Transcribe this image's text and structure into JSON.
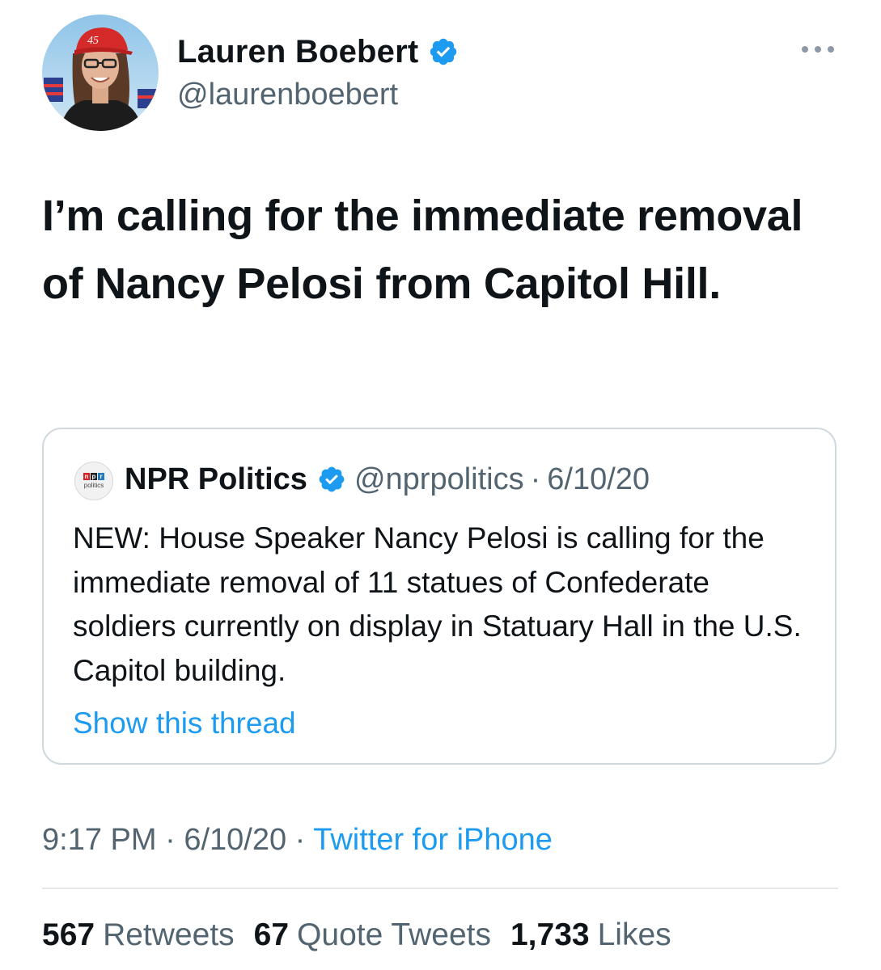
{
  "author": {
    "name": "Lauren Boebert",
    "handle": "@laurenboebert",
    "cap_text": "45"
  },
  "tweet": {
    "text": "I’m calling for the immediate removal of Nancy Pelosi from Capitol Hill."
  },
  "quote": {
    "name": "NPR Politics",
    "handle": "@nprpolitics",
    "separator": "·",
    "date": "6/10/20",
    "text": "NEW: House Speaker Nancy Pelosi is calling for the immediate removal of 11 statues of Confederate soldiers currently on display in Statuary Hall in the U.S. Capitol building.",
    "show_thread": "Show this thread",
    "logo_letters": [
      "n",
      "p",
      "r"
    ],
    "logo_sub": "politics"
  },
  "meta": {
    "time": "9:17 PM",
    "separator": "·",
    "date": "6/10/20",
    "source": "Twitter for iPhone"
  },
  "stats": {
    "retweets_count": "567",
    "retweets_label": "Retweets",
    "quotes_count": "67",
    "quotes_label": "Quote Tweets",
    "likes_count": "1,733",
    "likes_label": "Likes"
  },
  "colors": {
    "accent": "#1d9bf0",
    "secondary_text": "#536471",
    "border": "#cfd9de",
    "npr_red": "#d62021",
    "npr_black": "#222222",
    "npr_blue": "#237bbd"
  }
}
